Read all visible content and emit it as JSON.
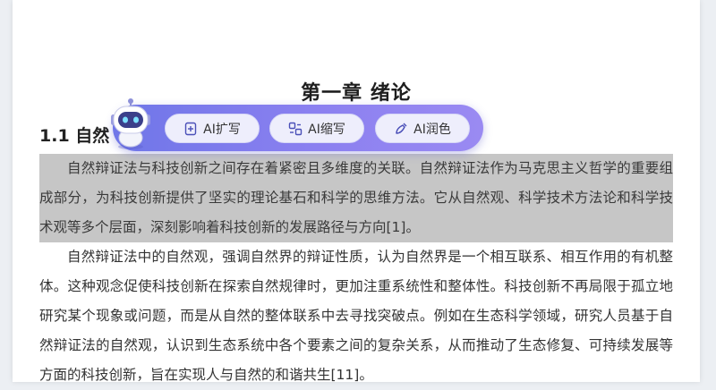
{
  "document": {
    "chapter_title": "第一章 绪论",
    "section_heading": "1.1 自然",
    "paragraphs": [
      "自然辩证法与科技创新之间存在着紧密且多维度的关联。自然辩证法作为马克思主义哲学的重要组成部分，为科技创新提供了坚实的理论基石和科学的思维方法。它从自然观、科学技术方法论和科学技术观等多个层面，深刻影响着科技创新的发展路径与方向[1]。",
      "自然辩证法中的自然观，强调自然界的辩证性质，认为自然界是一个相互联系、相互作用的有机整体。这种观念促使科技创新在探索自然规律时，更加注重系统性和整体性。科技创新不再局限于孤立地研究某个现象或问题，而是从自然的整体联系中去寻找突破点。例如在生态科学领域，研究人员基于自然辩证法的自然观，认识到生态系统中各个要素之间的复杂关系，从而推动了生态修复、可持续发展等方面的科技创新，旨在实现人与自然的和谐共生[11]。"
    ]
  },
  "ai_toolbar": {
    "buttons": [
      {
        "label": "AI扩写",
        "icon": "expand-icon"
      },
      {
        "label": "AI缩写",
        "icon": "shrink-icon"
      },
      {
        "label": "AI润色",
        "icon": "polish-icon"
      }
    ],
    "colors": {
      "bar_start": "#6f76e8",
      "bar_end": "#9a8af2",
      "button_bg": "#eeeefc",
      "selection": "#c6c6c6"
    }
  }
}
